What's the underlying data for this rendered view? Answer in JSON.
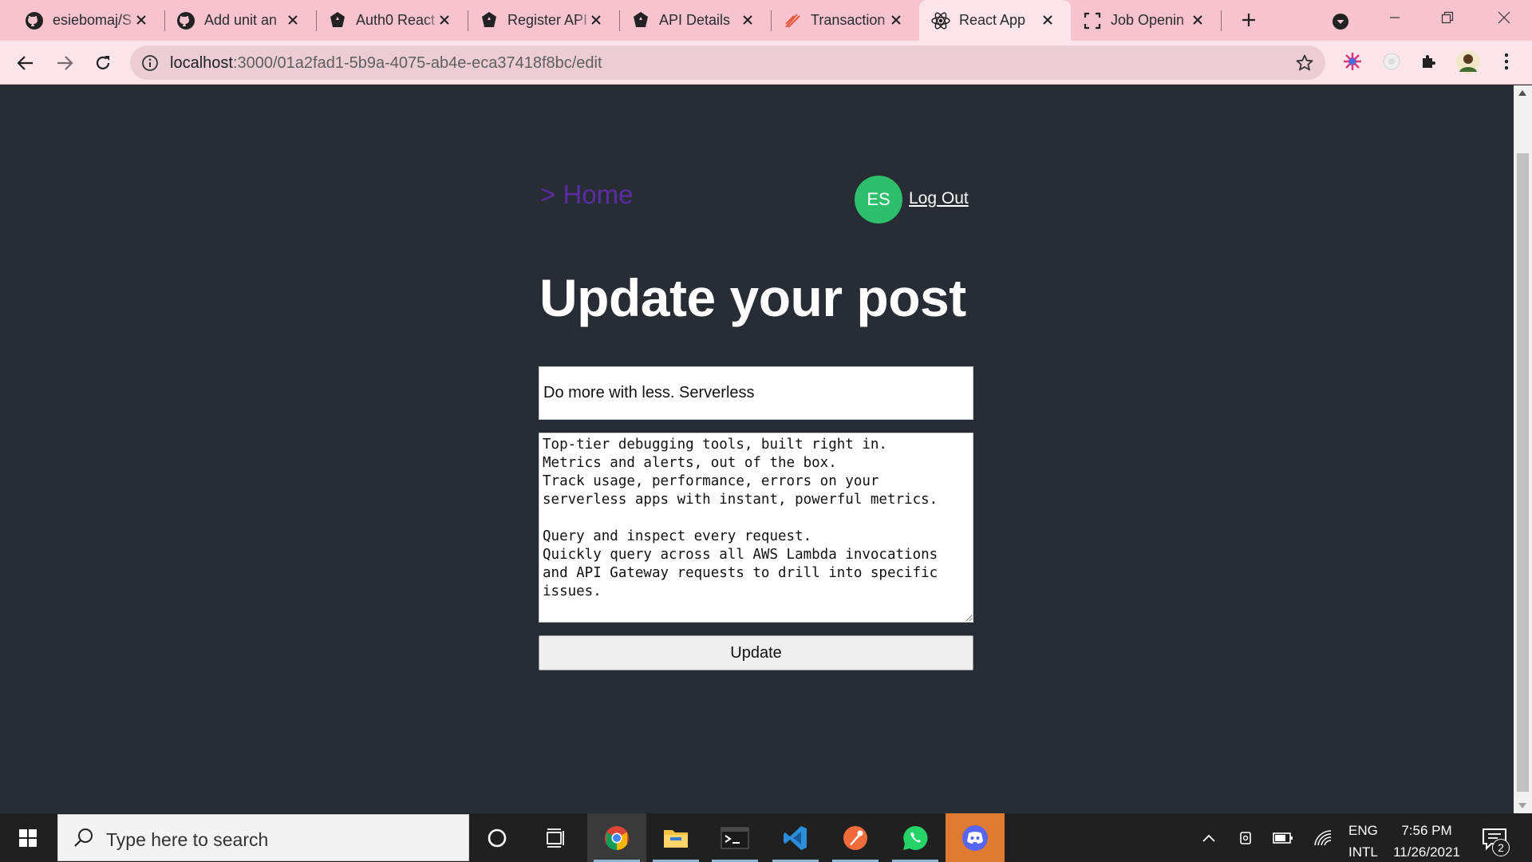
{
  "browser": {
    "tabs": [
      {
        "title": "esiebomaj/S",
        "icon": "github-icon"
      },
      {
        "title": "Add unit an",
        "icon": "github-icon"
      },
      {
        "title": "Auth0 React",
        "icon": "auth0-icon"
      },
      {
        "title": "Register API",
        "icon": "auth0-icon"
      },
      {
        "title": "API Details",
        "icon": "auth0-icon"
      },
      {
        "title": "Transaction",
        "icon": "postman-icon"
      },
      {
        "title": "React App",
        "icon": "react-icon",
        "active": true
      },
      {
        "title": "Job Openin",
        "icon": "expand-icon"
      }
    ],
    "url_host": "localhost",
    "url_path": ":3000/01a2fad1-5b9a-4075-ab4e-eca37418f8bc/edit",
    "colors": {
      "tabbar": "#f6c3cf",
      "toolbar": "#fbe4ea",
      "omnibox": "#eccdd5"
    }
  },
  "page": {
    "home_link": "> Home",
    "avatar_initials": "ES",
    "logout_label": "Log Out",
    "title": "Update your post",
    "post_title_value": "Do more with less. Serverless",
    "post_body_value": "Top-tier debugging tools, built right in.\nMetrics and alerts, out of the box.\nTrack usage, performance, errors on your serverless apps with instant, powerful metrics.\n\nQuery and inspect every request.\nQuickly query across all AWS Lambda invocations and API Gateway requests to drill into specific issues.",
    "update_label": "Update",
    "colors": {
      "background": "#282c34",
      "home_link": "#5b2ca4",
      "avatar": "#2dbf6b"
    }
  },
  "taskbar": {
    "search_placeholder": "Type here to search",
    "apps": [
      "cortana-icon",
      "task-view-icon",
      "chrome-icon",
      "file-explorer-icon",
      "terminal-icon",
      "vscode-icon",
      "postman-icon",
      "whatsapp-icon",
      "discord-icon"
    ],
    "lang_top": "ENG",
    "lang_bottom": "INTL",
    "time": "7:56 PM",
    "date": "11/26/2021",
    "notification_count": "2"
  }
}
